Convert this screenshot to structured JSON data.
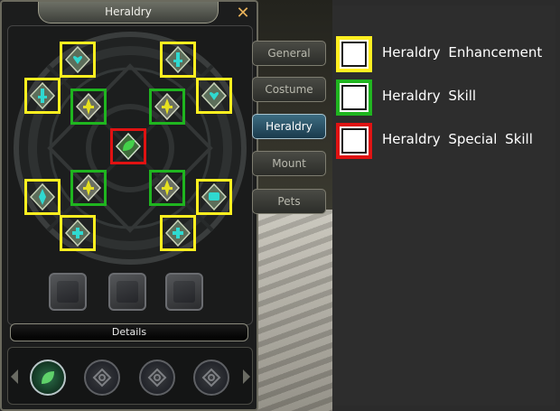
{
  "window": {
    "title": "Heraldry",
    "close_label": "✕",
    "details_label": "Details"
  },
  "tabs": [
    {
      "label": "General",
      "active": false
    },
    {
      "label": "Costume",
      "active": false
    },
    {
      "label": "Heraldry",
      "active": true
    },
    {
      "label": "Mount",
      "active": false
    },
    {
      "label": "Pets",
      "active": false
    }
  ],
  "slots": {
    "enhancement_count": 8,
    "skill_count": 4,
    "special_skill_count": 1,
    "empty_socket_count": 3
  },
  "legend": [
    {
      "label": "Heraldry Enhancement",
      "color": "#ffef1f",
      "icon": "yellow-box-icon"
    },
    {
      "label": "Heraldry Skill",
      "color": "#1fb51f",
      "icon": "green-box-icon"
    },
    {
      "label": "Heraldry Special Skill",
      "color": "#e01212",
      "icon": "red-box-icon"
    }
  ],
  "colors": {
    "enhancement": "#ffef1f",
    "skill": "#1fb51f",
    "special": "#e01212",
    "active_tab": "#3d6d82"
  }
}
